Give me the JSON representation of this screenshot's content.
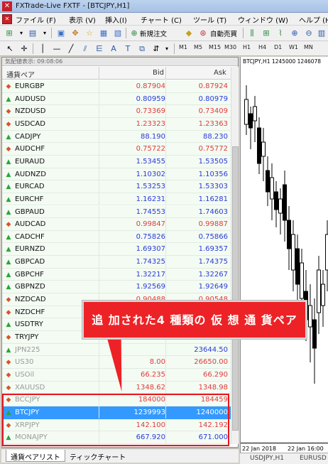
{
  "window": {
    "title": "FXTrade-Live FXTF - [BTCJPY,H1]"
  },
  "menu": [
    "ファイル (F)",
    "表示 (V)",
    "挿入(I)",
    "チャート (C)",
    "ツール (T)",
    "ウィンドウ (W)",
    "ヘルプ (H)"
  ],
  "toolbar": {
    "new_order": "新規注文",
    "auto_trade": "自動売買"
  },
  "timeframes": [
    "M1",
    "M5",
    "M15",
    "M30",
    "H1",
    "H4",
    "D1",
    "W1",
    "MN"
  ],
  "market_watch": {
    "caption": "気配値表示: 09:08:06",
    "headers": {
      "symbol": "通貨ペア",
      "bid": "Bid",
      "ask": "Ask"
    },
    "rows": [
      {
        "symbol": "EURGBP",
        "bid": "0.87904",
        "ask": "0.87924",
        "dir": "down",
        "color": "#e23b3b"
      },
      {
        "symbol": "AUDUSD",
        "bid": "0.80959",
        "ask": "0.80979",
        "dir": "up",
        "color": "#2a3ad8"
      },
      {
        "symbol": "NZDUSD",
        "bid": "0.73369",
        "ask": "0.73409",
        "dir": "down",
        "color": "#e23b3b"
      },
      {
        "symbol": "USDCAD",
        "bid": "1.23323",
        "ask": "1.23363",
        "dir": "down",
        "color": "#e23b3b"
      },
      {
        "symbol": "CADJPY",
        "bid": "88.190",
        "ask": "88.230",
        "dir": "up",
        "color": "#2a3ad8"
      },
      {
        "symbol": "AUDCHF",
        "bid": "0.75722",
        "ask": "0.75772",
        "dir": "down",
        "color": "#e23b3b"
      },
      {
        "symbol": "EURAUD",
        "bid": "1.53455",
        "ask": "1.53505",
        "dir": "up",
        "color": "#2a3ad8"
      },
      {
        "symbol": "AUDNZD",
        "bid": "1.10302",
        "ask": "1.10356",
        "dir": "up",
        "color": "#2a3ad8"
      },
      {
        "symbol": "EURCAD",
        "bid": "1.53253",
        "ask": "1.53303",
        "dir": "up",
        "color": "#2a3ad8"
      },
      {
        "symbol": "EURCHF",
        "bid": "1.16231",
        "ask": "1.16281",
        "dir": "up",
        "color": "#2a3ad8"
      },
      {
        "symbol": "GBPAUD",
        "bid": "1.74553",
        "ask": "1.74603",
        "dir": "up",
        "color": "#2a3ad8"
      },
      {
        "symbol": "AUDCAD",
        "bid": "0.99847",
        "ask": "0.99887",
        "dir": "down",
        "color": "#e23b3b"
      },
      {
        "symbol": "CADCHF",
        "bid": "0.75826",
        "ask": "0.75866",
        "dir": "up",
        "color": "#2a3ad8"
      },
      {
        "symbol": "EURNZD",
        "bid": "1.69307",
        "ask": "1.69357",
        "dir": "up",
        "color": "#2a3ad8"
      },
      {
        "symbol": "GBPCAD",
        "bid": "1.74325",
        "ask": "1.74375",
        "dir": "up",
        "color": "#2a3ad8"
      },
      {
        "symbol": "GBPCHF",
        "bid": "1.32217",
        "ask": "1.32267",
        "dir": "up",
        "color": "#2a3ad8"
      },
      {
        "symbol": "GBPNZD",
        "bid": "1.92569",
        "ask": "1.92649",
        "dir": "up",
        "color": "#2a3ad8"
      },
      {
        "symbol": "NZDCAD",
        "bid": "0.90488",
        "ask": "0.90548",
        "dir": "down",
        "color": "#e23b3b"
      },
      {
        "symbol": "NZDCHF",
        "bid": "",
        "ask": "",
        "dir": "down",
        "color": "#e23b3b"
      },
      {
        "symbol": "USDTRY",
        "bid": "",
        "ask": "",
        "dir": "up",
        "color": "#2a3ad8"
      },
      {
        "symbol": "TRYJPY",
        "bid": "",
        "ask": "",
        "dir": "down",
        "color": "#e23b3b"
      },
      {
        "symbol": "JPN225",
        "bid": "",
        "ask": "23644.50",
        "dir": "up",
        "color": "#2a3ad8",
        "dim": true
      },
      {
        "symbol": "US30",
        "bid": "8.00",
        "ask": "26650.00",
        "dir": "down",
        "color": "#e23b3b",
        "dim": true
      },
      {
        "symbol": "USOil",
        "bid": "66.235",
        "ask": "66.290",
        "dir": "down",
        "color": "#e23b3b",
        "dim": true
      },
      {
        "symbol": "XAUUSD",
        "bid": "1348.62",
        "ask": "1348.98",
        "dir": "down",
        "color": "#e23b3b",
        "dim": true
      },
      {
        "symbol": "BCCJPY",
        "bid": "184000",
        "ask": "184459",
        "dir": "down",
        "color": "#e23b3b",
        "dim": true
      },
      {
        "symbol": "BTCJPY",
        "bid": "1239993",
        "ask": "1240000",
        "dir": "up",
        "color": "#ffffff",
        "selected": true
      },
      {
        "symbol": "XRPJPY",
        "bid": "142.100",
        "ask": "142.192",
        "dir": "down",
        "color": "#e23b3b",
        "dim": true
      },
      {
        "symbol": "MONAJPY",
        "bid": "667.920",
        "ask": "671.000",
        "dir": "up",
        "color": "#2a3ad8",
        "dim": true
      }
    ]
  },
  "tabs": [
    "通貨ペアリスト",
    "ティックチャート"
  ],
  "chart": {
    "title": "BTCJPY,H1  1245000 1246078",
    "dates": [
      "22 Jan 2018",
      "22 Jan 16:00"
    ],
    "bottom_tabs": [
      "USDJPY,H1",
      "EURUSD"
    ]
  },
  "annotation": {
    "callout_text": "追 加された4 種類の 仮 想 通 貨ペア"
  },
  "colors": {
    "up_arrow": "#2aa53a",
    "down_arrow": "#d9542b",
    "selected_row": "#3399ff",
    "callout": "#ed2226"
  }
}
